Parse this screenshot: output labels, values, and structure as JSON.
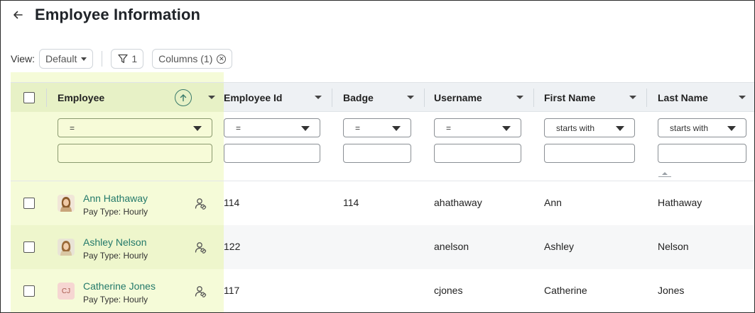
{
  "header": {
    "title": "Employee Information"
  },
  "toolbar": {
    "view_label": "View:",
    "view_value": "Default",
    "filter_count": "1",
    "columns_label": "Columns (1)"
  },
  "columns": {
    "employee": "Employee",
    "employee_id": "Employee Id",
    "badge": "Badge",
    "username": "Username",
    "first_name": "First Name",
    "last_name": "Last Name"
  },
  "filters": {
    "employee_op": "=",
    "employee_id_op": "=",
    "badge_op": "=",
    "username_op": "=",
    "first_name_op": "starts with",
    "last_name_op": "starts with"
  },
  "rows": [
    {
      "name": "Ann Hathaway",
      "pay_type": "Pay Type: Hourly",
      "avatar": "photo",
      "employee_id": "114",
      "badge": "114",
      "username": "ahathaway",
      "first_name": "Ann",
      "last_name": "Hathaway"
    },
    {
      "name": "Ashley Nelson",
      "pay_type": "Pay Type: Hourly",
      "avatar": "photo",
      "employee_id": "122",
      "badge": "",
      "username": "anelson",
      "first_name": "Ashley",
      "last_name": "Nelson"
    },
    {
      "name": "Catherine Jones",
      "pay_type": "Pay Type: Hourly",
      "avatar": "CJ",
      "employee_id": "117",
      "badge": "",
      "username": "cjones",
      "first_name": "Catherine",
      "last_name": "Jones"
    }
  ],
  "colors": {
    "accent": "#23796a",
    "pinned_highlight": "#f5fbd8",
    "header_bg": "#eef1f4"
  },
  "icons": [
    "back-arrow-icon",
    "chevron-down-icon",
    "filter-funnel-icon",
    "close-circle-icon",
    "sort-ascending-icon",
    "user-link-icon"
  ]
}
